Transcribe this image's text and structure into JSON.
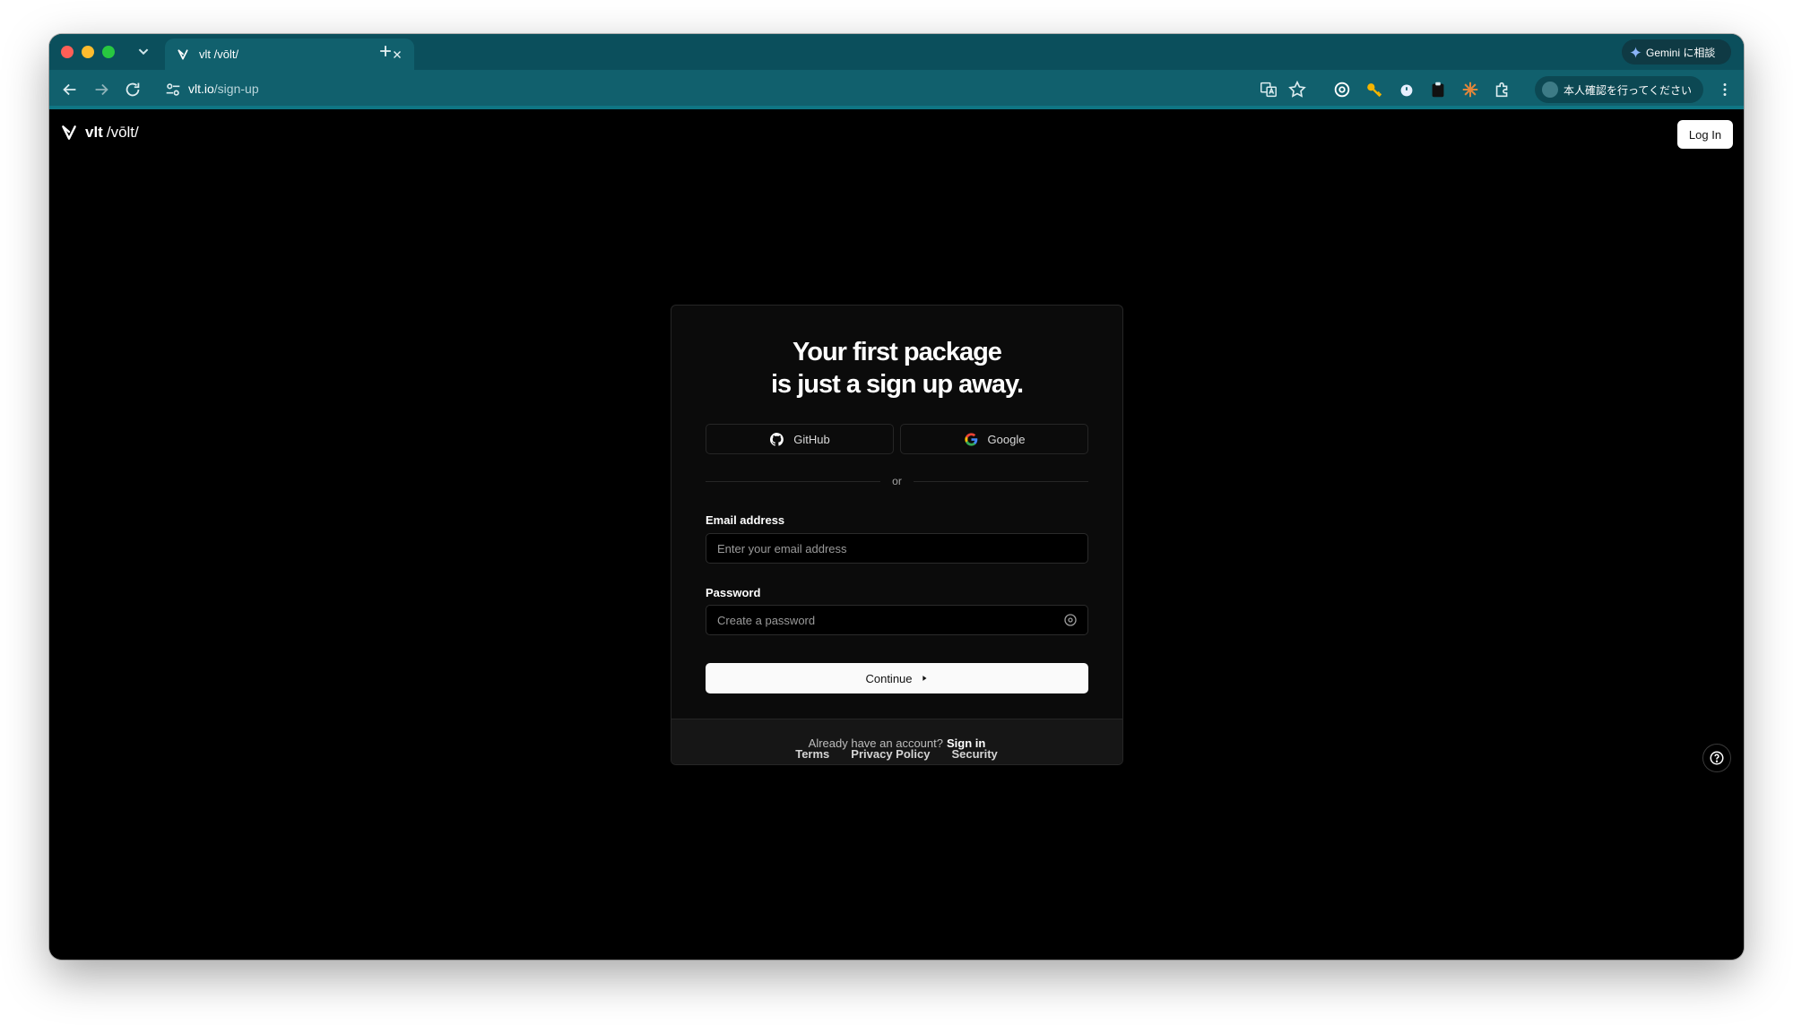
{
  "browser": {
    "tab_title": "vlt /vōlt/",
    "address_domain": "vlt.io",
    "address_path": "/sign-up",
    "gemini_label": "Gemini に相談",
    "profile_label": "本人確認を行ってください"
  },
  "header": {
    "brand_name": "vlt",
    "brand_pronunciation": "/vōlt/",
    "login_label": "Log In"
  },
  "card": {
    "title_line1": "Your first package",
    "title_line2": "is just a sign up away.",
    "github_label": "GitHub",
    "google_label": "Google",
    "divider_text": "or",
    "email_label": "Email address",
    "email_placeholder": "Enter your email address",
    "password_label": "Password",
    "password_placeholder": "Create a password",
    "continue_label": "Continue",
    "footer_question": "Already have an account?",
    "footer_link": "Sign in"
  },
  "footer": {
    "links": [
      "Terms",
      "Privacy Policy",
      "Security"
    ]
  }
}
